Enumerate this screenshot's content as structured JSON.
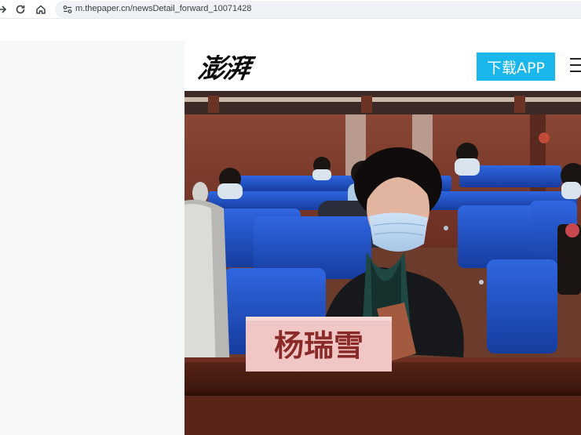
{
  "browser": {
    "url": "m.thepaper.cn/newsDetail_forward_10071428",
    "icons": [
      "forward-arrow-icon",
      "reload-icon",
      "home-icon",
      "site-info-icon"
    ]
  },
  "header": {
    "logo_text": "澎湃",
    "download_button": "下载APP",
    "menu_icon": "hamburger-menu-icon"
  },
  "article": {
    "photo": {
      "nameplate_text": "杨瑞雪"
    }
  },
  "colors": {
    "brand_blue": "#19b7eb",
    "seat_blue": "#1e4fc4",
    "wall_wood": "#7a3a2a"
  }
}
